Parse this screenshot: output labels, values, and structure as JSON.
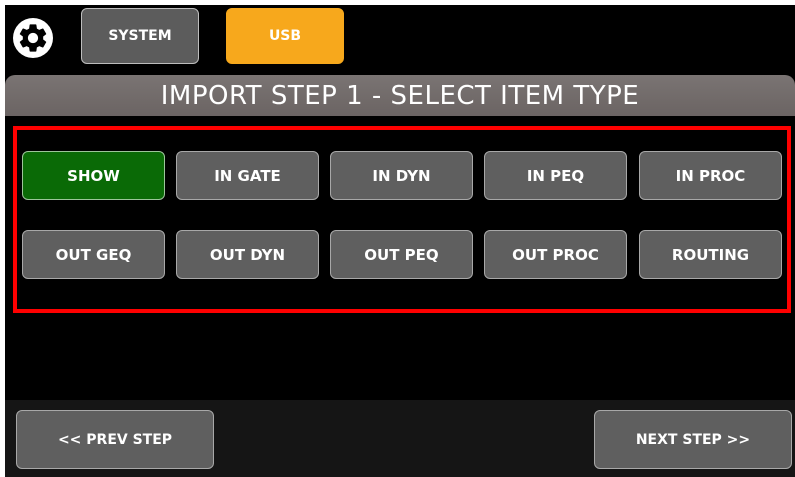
{
  "header": {
    "tabs": [
      {
        "label": "SYSTEM",
        "active": false
      },
      {
        "label": "USB",
        "active": true
      }
    ],
    "settings_icon": "gear-icon"
  },
  "banner": {
    "title": "IMPORT STEP 1 - SELECT ITEM TYPE"
  },
  "item_types": [
    {
      "label": "SHOW",
      "selected": true
    },
    {
      "label": "IN GATE",
      "selected": false
    },
    {
      "label": "IN DYN",
      "selected": false
    },
    {
      "label": "IN PEQ",
      "selected": false
    },
    {
      "label": "IN PROC",
      "selected": false
    },
    {
      "label": "OUT GEQ",
      "selected": false
    },
    {
      "label": "OUT DYN",
      "selected": false
    },
    {
      "label": "OUT PEQ",
      "selected": false
    },
    {
      "label": "OUT PROC",
      "selected": false
    },
    {
      "label": "ROUTING",
      "selected": false
    }
  ],
  "footer": {
    "prev_label": "<< PREV STEP",
    "next_label": "NEXT STEP >>"
  },
  "colors": {
    "accent_usb": "#f7a81c",
    "selected_green": "#0a6a06",
    "highlight_red": "#ff0000",
    "button_gray": "#5f5f5f"
  }
}
